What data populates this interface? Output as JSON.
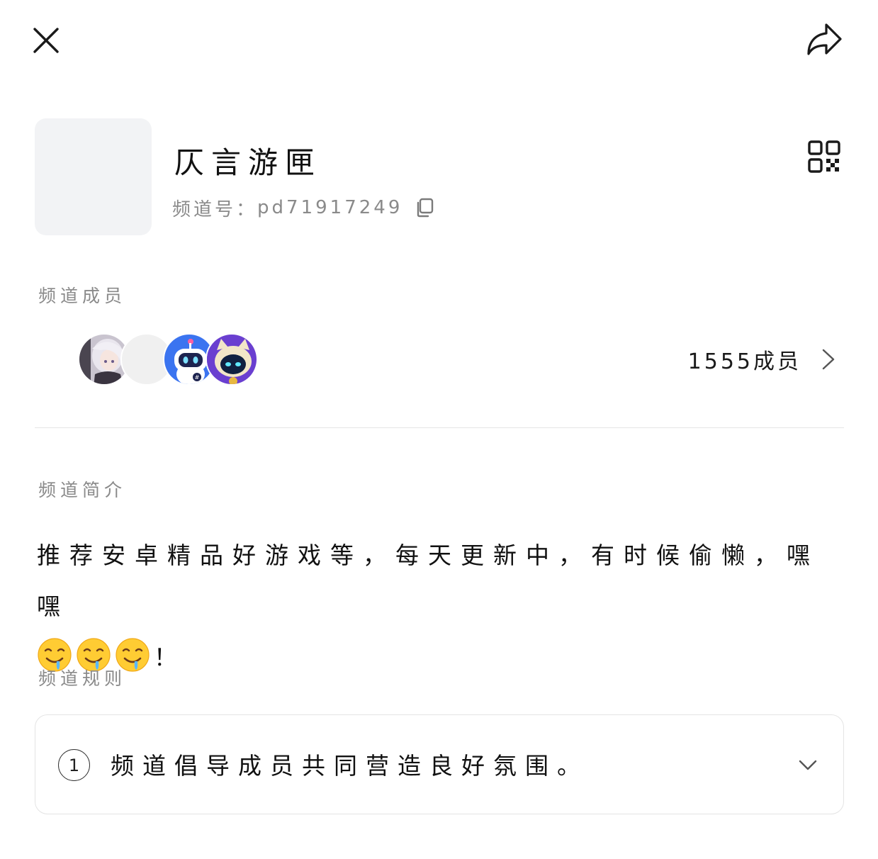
{
  "header": {
    "close_icon": "close-icon",
    "share_icon": "share-forward-icon"
  },
  "channel": {
    "name": "仄言游匣",
    "id_label": "频道号：",
    "id_value": "pd71917249",
    "copy_icon": "copy-icon",
    "qr_icon": "qr-code-icon"
  },
  "members": {
    "title": "频道成员",
    "count_label": "1555成员",
    "avatars": [
      "anime-girl-avatar",
      "blank-avatar",
      "robot-avatar",
      "cat-robot-avatar"
    ]
  },
  "intro": {
    "title": "频道简介",
    "text": "推荐安卓精品好游戏等，每天更新中，有时候偷懒，嘿嘿",
    "emoji": "drooling-face-emoji",
    "emoji_count": 3,
    "suffix": "！"
  },
  "rules": {
    "title": "频道规则",
    "items": [
      {
        "number": "1",
        "text": "频道倡导成员共同营造良好氛围。"
      }
    ]
  },
  "colors": {
    "primary_text": "#111111",
    "secondary_text": "#8a8a8a",
    "divider": "#e6e6e6",
    "placeholder": "#f2f3f5"
  }
}
